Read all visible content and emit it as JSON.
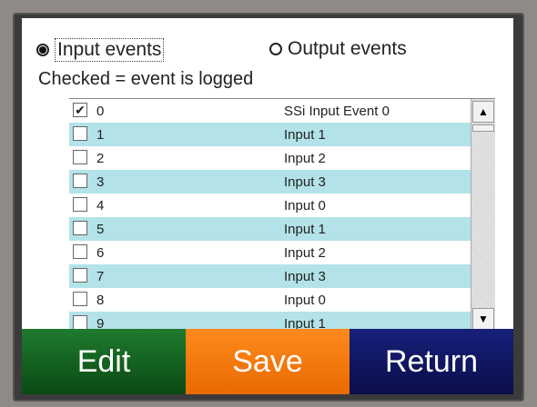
{
  "radios": {
    "input_label": "Input events",
    "output_label": "Output events",
    "selected": "input"
  },
  "note": "Checked = event is logged",
  "rows": [
    {
      "index": "0",
      "name": "SSi Input Event 0",
      "checked": true
    },
    {
      "index": "1",
      "name": "Input 1",
      "checked": false
    },
    {
      "index": "2",
      "name": "Input 2",
      "checked": false
    },
    {
      "index": "3",
      "name": "Input 3",
      "checked": false
    },
    {
      "index": "4",
      "name": "Input 0",
      "checked": false
    },
    {
      "index": "5",
      "name": "Input 1",
      "checked": false
    },
    {
      "index": "6",
      "name": "Input 2",
      "checked": false
    },
    {
      "index": "7",
      "name": "Input 3",
      "checked": false
    },
    {
      "index": "8",
      "name": "Input 0",
      "checked": false
    },
    {
      "index": "9",
      "name": "Input 1",
      "checked": false
    }
  ],
  "buttons": {
    "edit": "Edit",
    "save": "Save",
    "return": "Return"
  },
  "colors": {
    "edit": "#1f7a2e",
    "save": "#ff8a1e",
    "return": "#17207a",
    "row_alt": "#b3e3e8"
  }
}
